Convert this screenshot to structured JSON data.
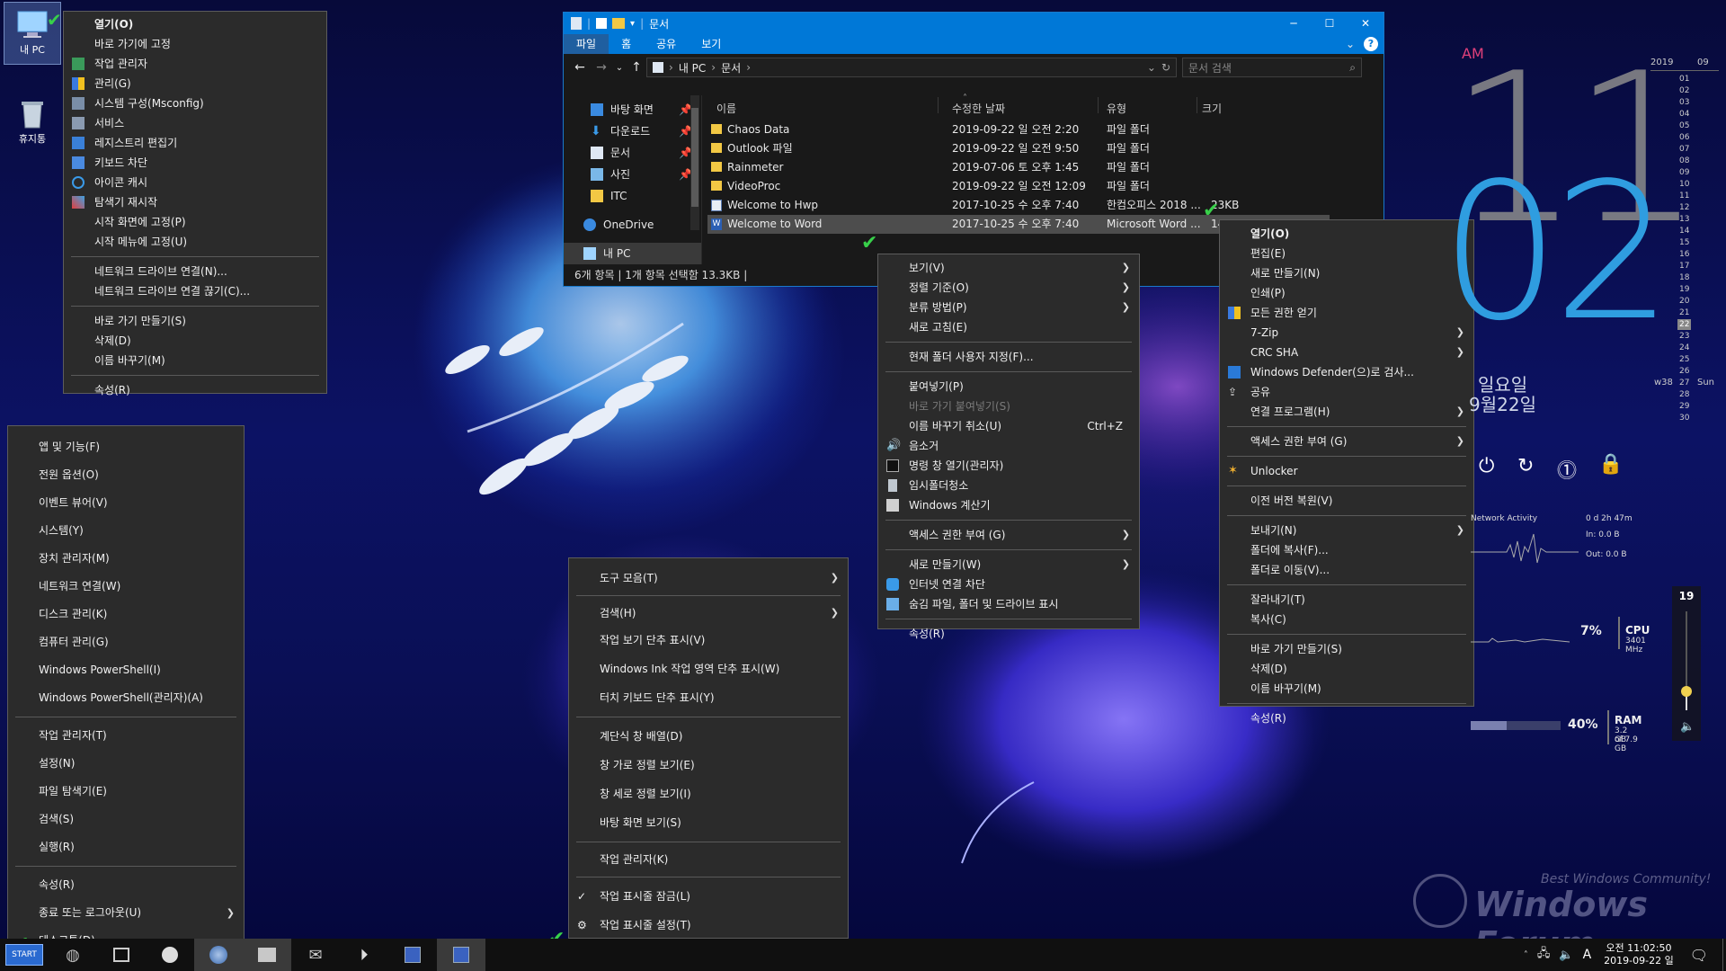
{
  "desktop": {
    "icons": [
      {
        "label": "내 PC",
        "icon": "computer-icon"
      },
      {
        "label": "휴지통",
        "icon": "recycle-bin-icon"
      }
    ]
  },
  "computer_menu": {
    "items": [
      {
        "label": "열기(O)",
        "bold": true
      },
      {
        "label": "바로 가기에 고정"
      },
      {
        "label": "작업 관리자",
        "icon": "task-manager-icon"
      },
      {
        "label": "관리(G)",
        "icon": "shield-icon"
      },
      {
        "label": "시스템 구성(Msconfig)",
        "icon": "msconfig-icon"
      },
      {
        "label": "서비스",
        "icon": "services-icon"
      },
      {
        "label": "레지스트리 편집기",
        "icon": "registry-icon"
      },
      {
        "label": "키보드 차단",
        "icon": "keyboard-icon"
      },
      {
        "label": "아이콘 캐시",
        "icon": "refresh-icon"
      },
      {
        "label": "탐색기 재시작",
        "icon": "explorer-restart-icon"
      },
      {
        "label": "시작 화면에 고정(P)"
      },
      {
        "label": "시작 메뉴에 고정(U)"
      },
      {
        "sep": true
      },
      {
        "label": "네트워크 드라이브 연결(N)..."
      },
      {
        "label": "네트워크 드라이브 연결 끊기(C)..."
      },
      {
        "sep": true
      },
      {
        "label": "바로 가기 만들기(S)"
      },
      {
        "label": "삭제(D)"
      },
      {
        "label": "이름 바꾸기(M)"
      },
      {
        "sep": true
      },
      {
        "label": "속성(R)"
      }
    ]
  },
  "winx_menu": {
    "items": [
      {
        "label": "앱 및 기능(F)"
      },
      {
        "label": "전원 옵션(O)"
      },
      {
        "label": "이벤트 뷰어(V)"
      },
      {
        "label": "시스템(Y)"
      },
      {
        "label": "장치 관리자(M)"
      },
      {
        "label": "네트워크 연결(W)"
      },
      {
        "label": "디스크 관리(K)"
      },
      {
        "label": "컴퓨터 관리(G)"
      },
      {
        "label": "Windows PowerShell(I)"
      },
      {
        "label": "Windows PowerShell(관리자)(A)"
      },
      {
        "sep": true
      },
      {
        "label": "작업 관리자(T)"
      },
      {
        "label": "설정(N)"
      },
      {
        "label": "파일 탐색기(E)"
      },
      {
        "label": "검색(S)"
      },
      {
        "label": "실행(R)"
      },
      {
        "sep": true
      },
      {
        "label": "속성(R)"
      },
      {
        "label": "종료 또는 로그아웃(U)",
        "submenu": true
      },
      {
        "label": "데스크톱(D)"
      }
    ]
  },
  "explorer": {
    "title": "문서",
    "ribbon_tabs": [
      "파일",
      "홈",
      "공유",
      "보기"
    ],
    "breadcrumb": [
      "내 PC",
      "문서"
    ],
    "search_placeholder": "문서 검색",
    "nav_items": [
      {
        "label": "바탕 화면",
        "icon": "desktop-folder-icon",
        "pinned": true
      },
      {
        "label": "다운로드",
        "icon": "download-icon",
        "pinned": true
      },
      {
        "label": "문서",
        "icon": "documents-icon",
        "pinned": true
      },
      {
        "label": "사진",
        "icon": "pictures-icon",
        "pinned": true
      },
      {
        "label": "ITC",
        "icon": "folder-icon",
        "pinned": false
      },
      {
        "label": "OneDrive",
        "icon": "onedrive-icon",
        "pinned": false
      },
      {
        "label": "내 PC",
        "icon": "computer-icon",
        "pinned": false,
        "selected": true
      }
    ],
    "columns": [
      "이름",
      "수정한 날짜",
      "유형",
      "크기"
    ],
    "files": [
      {
        "name": "Chaos Data",
        "date": "2019-09-22 일 오전 2:20",
        "type": "파일 폴더",
        "size": "",
        "icon": "folder-icon"
      },
      {
        "name": "Outlook 파일",
        "date": "2019-09-22 일 오전 9:50",
        "type": "파일 폴더",
        "size": "",
        "icon": "folder-icon"
      },
      {
        "name": "Rainmeter",
        "date": "2019-07-06 토 오후 1:45",
        "type": "파일 폴더",
        "size": "",
        "icon": "folder-icon"
      },
      {
        "name": "VideoProc",
        "date": "2019-09-22 일 오전 12:09",
        "type": "파일 폴더",
        "size": "",
        "icon": "folder-icon"
      },
      {
        "name": "Welcome to Hwp",
        "date": "2017-10-25 수 오후 7:40",
        "type": "한컴오피스 2018 ...",
        "size": "23KB",
        "icon": "hwp-file-icon"
      },
      {
        "name": "Welcome to Word",
        "date": "2017-10-25 수 오후 7:40",
        "type": "Microsoft Word ...",
        "size": "14KB",
        "icon": "word-file-icon",
        "selected": true
      }
    ],
    "status": "6개 항목  |  1개 항목 선택함 13.3KB  |"
  },
  "folder_bg_menu": {
    "items": [
      {
        "label": "보기(V)",
        "submenu": true
      },
      {
        "label": "정렬 기준(O)",
        "submenu": true
      },
      {
        "label": "분류 방법(P)",
        "submenu": true
      },
      {
        "label": "새로 고침(E)"
      },
      {
        "sep": true
      },
      {
        "label": "현재 폴더 사용자 지정(F)..."
      },
      {
        "sep": true
      },
      {
        "label": "붙여넣기(P)"
      },
      {
        "label": "바로 가기 붙여넣기(S)",
        "disabled": true
      },
      {
        "label": "이름 바꾸기 취소(U)",
        "accel": "Ctrl+Z"
      },
      {
        "label": "음소거",
        "icon": "speaker-icon"
      },
      {
        "label": "명령 창 열기(관리자)",
        "icon": "cmd-icon"
      },
      {
        "label": "임시폴더청소",
        "icon": "trash-icon"
      },
      {
        "label": "Windows 계산기",
        "icon": "calculator-icon"
      },
      {
        "sep": true
      },
      {
        "label": "액세스 권한 부여 (G)",
        "submenu": true
      },
      {
        "sep": true
      },
      {
        "label": "새로 만들기(W)",
        "submenu": true
      },
      {
        "label": "인터넷 연결 차단",
        "icon": "network-icon"
      },
      {
        "label": "숨김 파일, 폴더 및 드라이브 표시",
        "icon": "hidden-files-icon"
      },
      {
        "sep": true
      },
      {
        "label": "속성(R)"
      }
    ]
  },
  "file_menu": {
    "items": [
      {
        "label": "열기(O)",
        "bold": true
      },
      {
        "label": "편집(E)"
      },
      {
        "label": "새로 만들기(N)"
      },
      {
        "label": "인쇄(P)"
      },
      {
        "label": "모든 권한 얻기",
        "icon": "shield-icon"
      },
      {
        "label": "7-Zip",
        "submenu": true
      },
      {
        "label": "CRC SHA",
        "submenu": true
      },
      {
        "label": "Windows Defender(으)로 검사...",
        "icon": "defender-icon"
      },
      {
        "label": "공유",
        "icon": "share-icon"
      },
      {
        "label": "연결 프로그램(H)",
        "submenu": true
      },
      {
        "sep": true
      },
      {
        "label": "액세스 권한 부여 (G)",
        "submenu": true
      },
      {
        "sep": true
      },
      {
        "label": "Unlocker",
        "icon": "unlocker-icon"
      },
      {
        "sep": true
      },
      {
        "label": "이전 버전 복원(V)"
      },
      {
        "sep": true
      },
      {
        "label": "보내기(N)",
        "submenu": true
      },
      {
        "label": "폴더에 복사(F)..."
      },
      {
        "label": "폴더로 이동(V)..."
      },
      {
        "sep": true
      },
      {
        "label": "잘라내기(T)"
      },
      {
        "label": "복사(C)"
      },
      {
        "sep": true
      },
      {
        "label": "바로 가기 만들기(S)"
      },
      {
        "label": "삭제(D)"
      },
      {
        "label": "이름 바꾸기(M)"
      },
      {
        "sep": true
      },
      {
        "label": "속성(R)"
      }
    ]
  },
  "taskbar_menu": {
    "items": [
      {
        "label": "도구 모음(T)",
        "submenu": true
      },
      {
        "sep": true
      },
      {
        "label": "검색(H)",
        "submenu": true
      },
      {
        "label": "작업 보기 단추 표시(V)"
      },
      {
        "label": "Windows Ink 작업 영역 단추 표시(W)"
      },
      {
        "label": "터치 키보드 단추 표시(Y)"
      },
      {
        "sep": true
      },
      {
        "label": "계단식 창 배열(D)"
      },
      {
        "label": "창 가로 정렬 보기(E)"
      },
      {
        "label": "창 세로 정렬 보기(I)"
      },
      {
        "label": "바탕 화면 보기(S)"
      },
      {
        "sep": true
      },
      {
        "label": "작업 관리자(K)"
      },
      {
        "sep": true
      },
      {
        "label": "작업 표시줄 잠금(L)",
        "checked": true
      },
      {
        "label": "작업 표시줄 설정(T)",
        "icon": "gear-icon"
      }
    ]
  },
  "clock_widget": {
    "ampm": "AM",
    "hour": "11",
    "minute": "02",
    "day_name": "일요일",
    "date_text": "9월22일",
    "year": "2019",
    "month": "09",
    "week_label": "w38",
    "today": "22",
    "today_dayname": "Sun",
    "days": [
      "01",
      "02",
      "03",
      "04",
      "05",
      "06",
      "07",
      "08",
      "09",
      "10",
      "11",
      "12",
      "13",
      "14",
      "15",
      "16",
      "17",
      "18",
      "19",
      "20",
      "21",
      "22",
      "23",
      "24",
      "25",
      "26",
      "27",
      "28",
      "29",
      "30"
    ]
  },
  "network_widget": {
    "title": "Network Activity",
    "uptime": "0 d 2h 47m",
    "in": "In: 0.0 B",
    "out": "Out: 0.0 B"
  },
  "cpu_widget": {
    "percent": "7%",
    "label": "CPU",
    "sub": "3401 MHz",
    "value": 0.07
  },
  "ram_widget": {
    "percent": "40%",
    "label": "RAM",
    "sub1": "3.2 GB",
    "sub2": "of 7.9 GB",
    "value": 0.4
  },
  "volume_widget": {
    "value": "19",
    "level": 0.19
  },
  "watermark": {
    "small": "Best Windows Community!",
    "big": "Windows Forum"
  },
  "taskbar": {
    "start_label": "START",
    "icons": [
      "globe-icon",
      "window-icon",
      "record-icon",
      "browser-icon",
      "folder-icon",
      "mail-icon",
      "media-icon",
      "save-icon",
      "save-icon"
    ],
    "tray_ime": "A",
    "time": "오전 11:02:50",
    "date": "2019-09-22 일"
  },
  "colors": {
    "accent": "#0078d7",
    "clock_blue": "#2f9de0",
    "clock_gray": "#8c8c8c",
    "ampm": "#e0407a",
    "menu_bg": "#2b2b2b",
    "check_green": "#38d04a"
  }
}
